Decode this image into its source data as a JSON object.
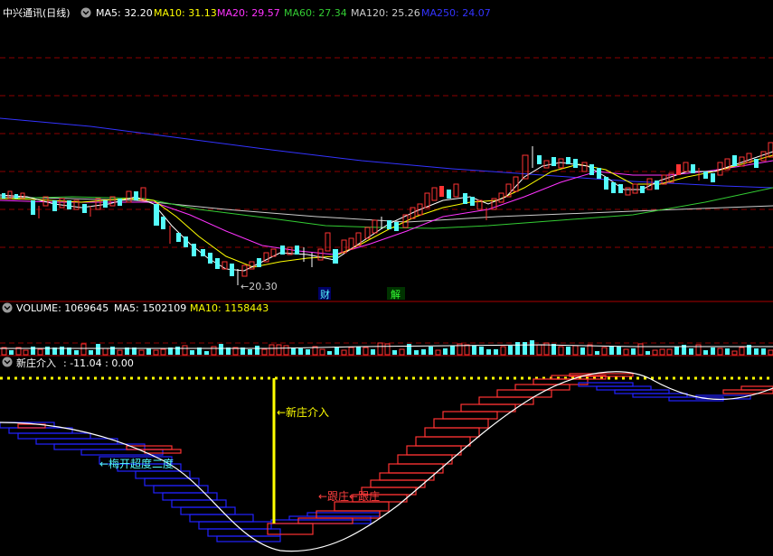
{
  "price_panel": {
    "stock_title": "中兴通讯(日线)",
    "ma5_label": "MA5: 32.20",
    "ma10_label": "MA10: 31.13",
    "ma20_label": "MA20: 29.57",
    "ma60_label": "MA60: 27.34",
    "ma120_label": "MA120: 25.26",
    "ma250_label": "MA250: 24.07",
    "low_marker": "←20.30",
    "badge_cai": "财",
    "badge_jie": "解"
  },
  "volume_panel": {
    "volume_label": "VOLUME: 1069645",
    "ma5_label": "MA5: 1502109",
    "ma10_label": "MA10: 1158443"
  },
  "indicator_panel": {
    "title": "新庄介入",
    "values_label": ": -11.04 : 0.00",
    "annot_new_entry": "←新庄介入",
    "annot_follow": "←跟庄←跟庄",
    "annot_plum": "←梅开超度二度"
  },
  "colors": {
    "ma5": "#ffffff",
    "ma10": "#ffff00",
    "ma20": "#ff33ff",
    "ma60": "#33cc33",
    "ma120": "#cccccc",
    "ma250": "#3333ff",
    "up": "#ff3333",
    "down": "#54fcfc",
    "grid": "#8b0000",
    "dotline": "#ffff00",
    "accent_red": "#ff4040"
  },
  "chart_data": {
    "type": "candlestick",
    "title": "中兴通讯(日线)",
    "ma": {
      "MA5": 32.2,
      "MA10": 31.13,
      "MA20": 29.57,
      "MA60": 27.34,
      "MA120": 25.26,
      "MA250": 24.07
    },
    "low_annotation": 20.3,
    "volume": {
      "VOLUME": 1069645,
      "MA5": 1502109,
      "MA10": 1158443
    },
    "indicator": {
      "name": "新庄介入",
      "value": -11.04,
      "baseline": 0.0
    }
  }
}
